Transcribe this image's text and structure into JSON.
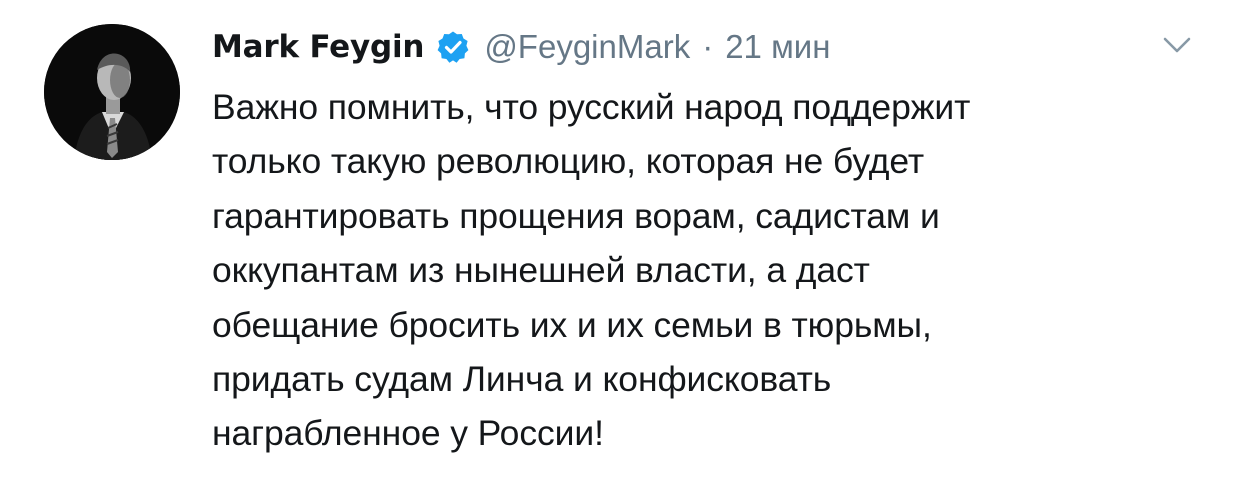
{
  "tweet": {
    "display_name": "Mark Feygin",
    "verified": true,
    "handle": "@FeyginMark",
    "separator": "·",
    "time": "21 мин",
    "text_lines": [
      "Важно помнить, что русский народ поддержит",
      "только такую революцию, которая не будет",
      "гарантировать прощения ворам, садистам и",
      "оккупантам из нынешней власти, а даст",
      "обещание бросить их и их семьи в тюрьмы,",
      "придать судам Линча и конфисковать",
      "награбленное у России!"
    ]
  },
  "icons": {
    "avatar": "profile-photo",
    "verified": "verified-badge-icon",
    "menu": "chevron-down-icon"
  },
  "colors": {
    "name": "#14171a",
    "muted": "#657786",
    "verified": "#1da1f2",
    "text": "#14171a",
    "background": "#ffffff"
  }
}
